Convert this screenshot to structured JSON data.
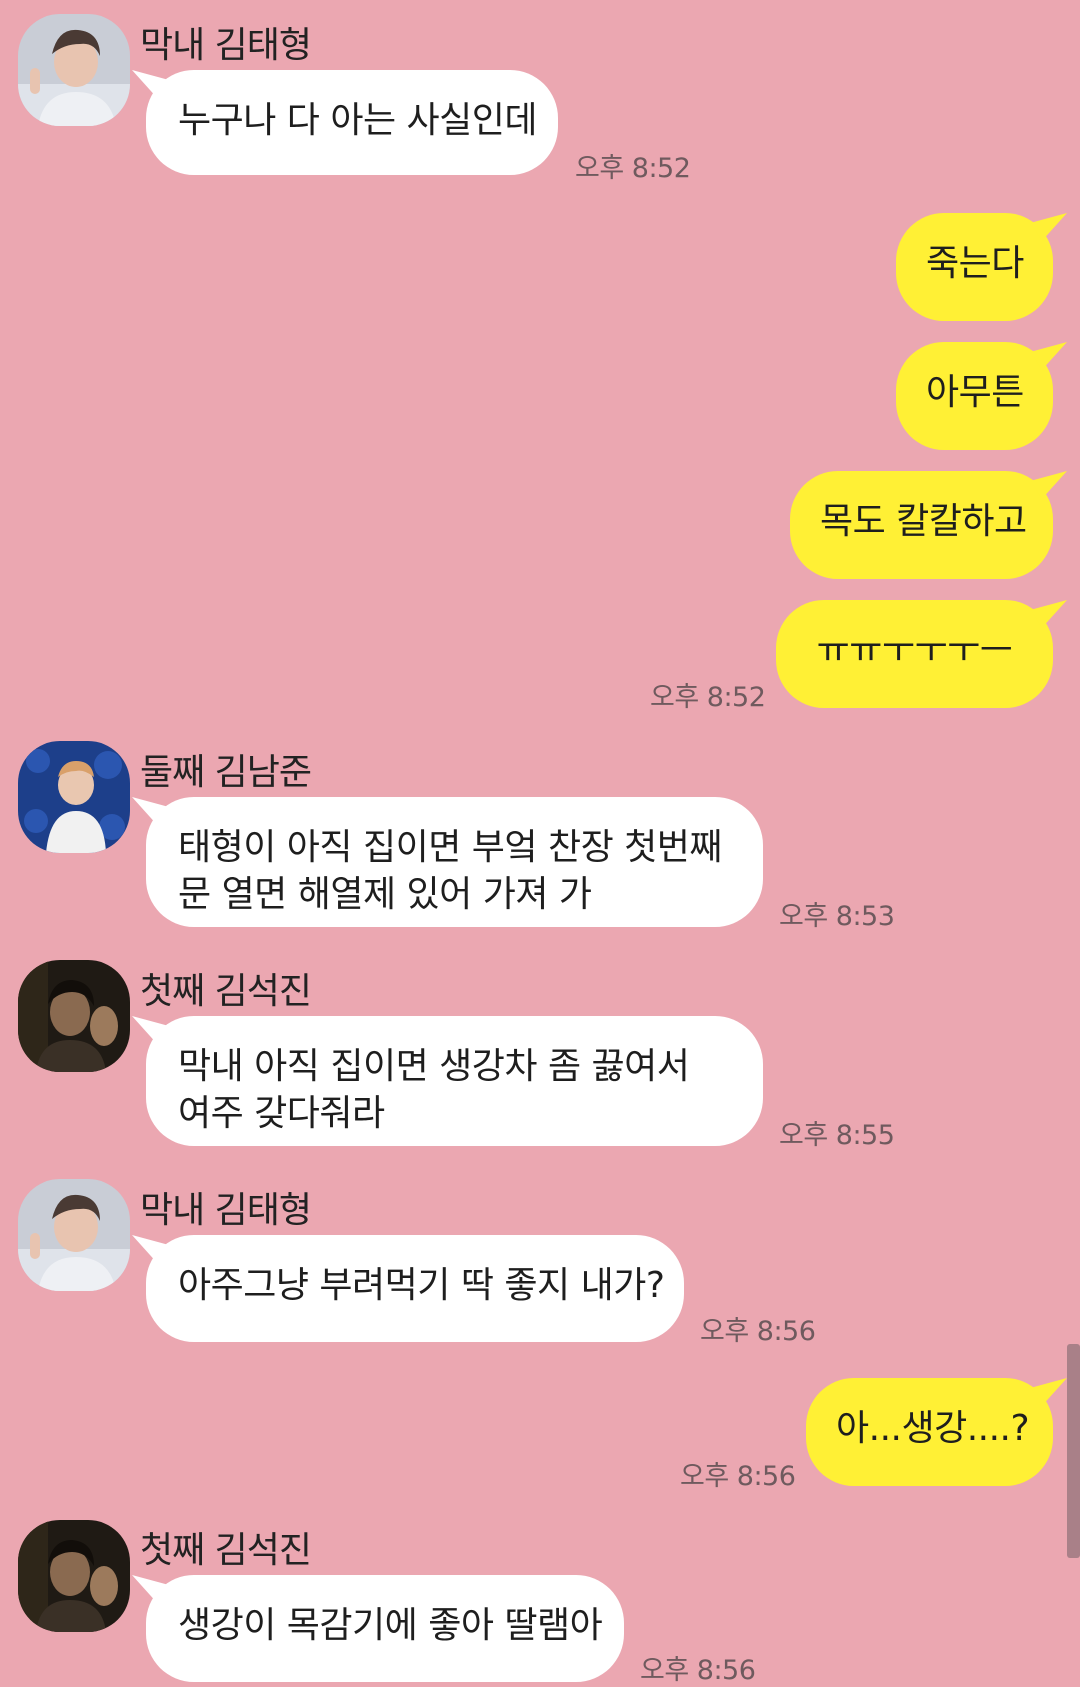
{
  "senders": {
    "taehyung": "막내 김태형",
    "namjoon": "둘째 김남준",
    "seokjin": "첫째 김석진"
  },
  "messages": [
    {
      "from": "막내 김태형",
      "text": [
        "누구나 다 아는 사실인데"
      ],
      "time": "오후 8:52"
    },
    {
      "from": "me",
      "text": [
        "죽는다"
      ]
    },
    {
      "from": "me",
      "text": [
        "아무튼"
      ]
    },
    {
      "from": "me",
      "text": [
        "목도 칼칼하고"
      ]
    },
    {
      "from": "me",
      "text": [
        "ㅠㅠㅜㅜㅜㅡ"
      ],
      "time": "오후 8:52"
    },
    {
      "from": "둘째 김남준",
      "text": [
        "태형이 아직 집이면 부엌 찬장 첫번째",
        "문 열면 해열제 있어 가져 가"
      ],
      "time": "오후 8:53"
    },
    {
      "from": "첫째 김석진",
      "text": [
        "막내 아직 집이면 생강차 좀 끓여서",
        "여주 갖다줘라"
      ],
      "time": "오후 8:55"
    },
    {
      "from": "막내 김태형",
      "text": [
        "아주그냥 부려먹기 딱 좋지 내가?"
      ],
      "time": "오후 8:56"
    },
    {
      "from": "me",
      "text": [
        "아...생강....?"
      ],
      "time": "오후 8:56"
    },
    {
      "from": "첫째 김석진",
      "text": [
        "생강이 목감기에 좋아 딸램아"
      ],
      "time": "오후 8:56"
    }
  ],
  "colors": {
    "background": "#eba7b1",
    "incoming_bubble": "#ffffff",
    "outgoing_bubble": "#fff035",
    "timestamp": "#6f5a5e"
  }
}
